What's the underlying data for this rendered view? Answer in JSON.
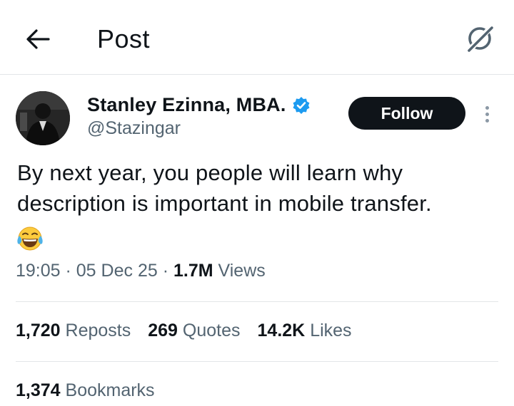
{
  "header": {
    "title": "Post",
    "back_icon": "arrow-left-icon",
    "grok_icon": "grok-icon"
  },
  "author": {
    "name": "Stanley Ezinna, MBA.",
    "handle": "@Stazingar",
    "verified_color": "#1d9bf0"
  },
  "follow_label": "Follow",
  "post": {
    "text": "By next year, you people will learn why description is important in mobile transfer.",
    "emoji": "face-with-tears-of-joy"
  },
  "meta": {
    "time": "19:05",
    "date": "05 Dec 25",
    "views_count": "1.7M",
    "views_label": "Views"
  },
  "stats": {
    "reposts_count": "1,720",
    "reposts_label": "Reposts",
    "quotes_count": "269",
    "quotes_label": "Quotes",
    "likes_count": "14.2K",
    "likes_label": "Likes",
    "bookmarks_count": "1,374",
    "bookmarks_label": "Bookmarks"
  }
}
